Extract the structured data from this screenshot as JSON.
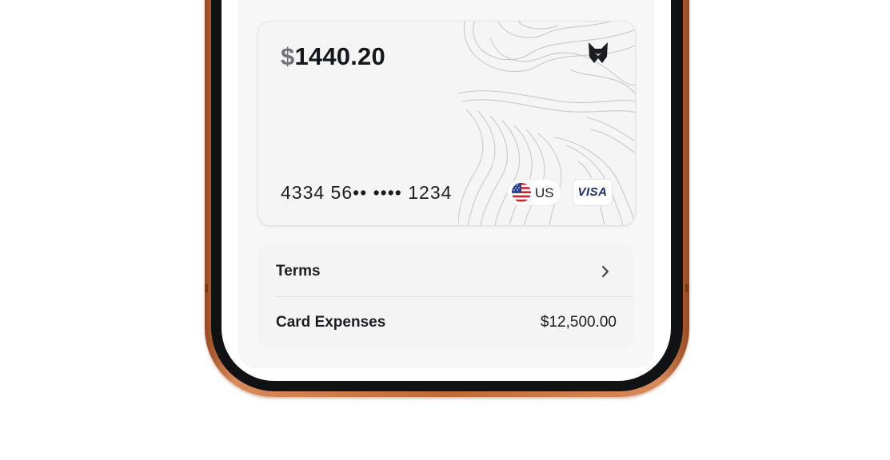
{
  "card": {
    "currency_symbol": "$",
    "balance": "1440.20",
    "number": "4334 56•• •••• 1234",
    "country_code": "US",
    "network": "VISA",
    "logo_icon": "wolf-logo-icon",
    "flag_icon": "us-flag-icon"
  },
  "details": {
    "terms_label": "Terms",
    "expenses_label": "Card Expenses",
    "expenses_value": "$12,500.00"
  },
  "colors": {
    "frame": "#c06a38",
    "visa_blue": "#1a2a78",
    "text_dark": "#15171a"
  }
}
